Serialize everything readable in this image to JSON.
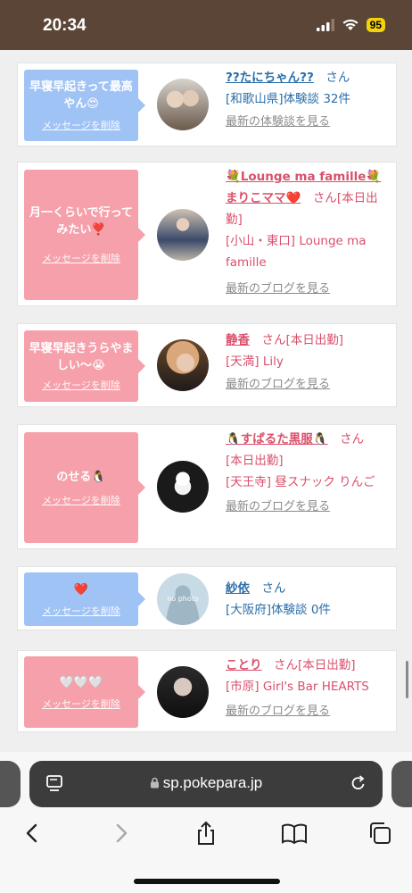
{
  "status_bar": {
    "time": "20:34",
    "battery": "95"
  },
  "common": {
    "delete_label": "メッセージを削除",
    "san": "さん"
  },
  "cards": [
    {
      "message": "早寝早起きって最高やん😍",
      "bubble_color": "blue",
      "name": "??たにちゃん??",
      "tag": "",
      "location": "[和歌山県]体験談 32件",
      "link": "最新の体験談を見る"
    },
    {
      "message": "月一くらいで行ってみたい❣️",
      "bubble_color": "pink",
      "name": "💐Lounge ma famille💐まりこママ❤️",
      "tag": "[本日出勤]",
      "location": "[小山・東口] Lounge ma famille",
      "link": "最新のブログを見る"
    },
    {
      "message": "早寝早起きうらやましい〜😭",
      "bubble_color": "pink",
      "name": "静香",
      "tag": "[本日出勤]",
      "location": "[天満] Lily",
      "link": "最新のブログを見る"
    },
    {
      "message": "のせる🐧",
      "bubble_color": "pink",
      "name": "🐧すぱるた黒服🐧",
      "tag": "[本日出勤]",
      "location": "[天王寺] 昼スナック りんご",
      "link": "最新のブログを見る"
    },
    {
      "message": "❤️",
      "bubble_color": "blue",
      "name": "紗依",
      "tag": "",
      "location": "[大阪府]体験談 0件",
      "link": "",
      "avatar_text": "no photo"
    },
    {
      "message": "🤍🤍🤍",
      "bubble_color": "pink",
      "name": "ことり",
      "tag": "[本日出勤]",
      "location": "[市原] Girl's Bar HEARTS",
      "link": "最新のブログを見る"
    }
  ],
  "browser": {
    "url": "sp.pokepara.jp"
  },
  "colors": {
    "pink": "#f5a0aa",
    "blue": "#a0c3f5",
    "accent_pink": "#d9506b",
    "accent_blue": "#2a6ea8"
  }
}
